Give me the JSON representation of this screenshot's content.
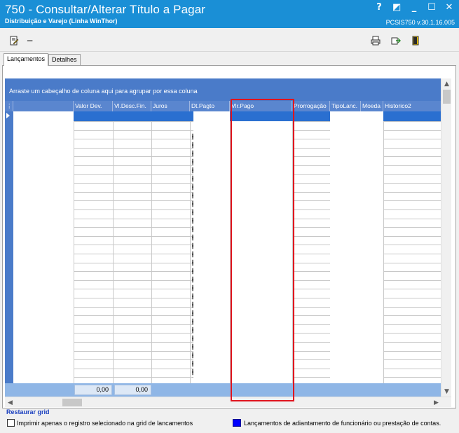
{
  "window": {
    "title": "750 - Consultar/Alterar Título a Pagar",
    "subtitle": "Distribuição e Varejo (Linha WinThor)",
    "version": "PCSIS750  v.30.1.16.005",
    "controls": [
      "?",
      "◩",
      "_",
      "☐",
      "✕"
    ]
  },
  "toolbar": {
    "left_icons": [
      "edit-document-icon",
      "minus-icon"
    ],
    "right_icons": [
      "print-icon",
      "export-icon",
      "exit-door-icon"
    ],
    "minus_glyph": "−"
  },
  "tabs": [
    {
      "label": "Lançamentos",
      "active": true
    },
    {
      "label": "Detalhes",
      "active": false
    }
  ],
  "grid": {
    "group_hint": "Arraste um cabeçalho de coluna aqui para agrupar por essa coluna",
    "columns": [
      "",
      "Valor Dev.",
      "Vl.Desc.Fin.",
      "Juros",
      "Dt.Pagto",
      "Vlr.Pago",
      "Prorrogação",
      "TipoLanc.",
      "Moeda",
      "Historico2"
    ],
    "totals": {
      "valor_dev": "0,00",
      "vl_desc_fin": "0,00"
    },
    "selection_color": "#2a6fd0",
    "header_color": "#5a86cf"
  },
  "footer": {
    "restore_label": "Restaurar grid",
    "print_only_label": "Imprimir apenas o registro selecionado na grid de lancamentos",
    "legend_label": "Lançamentos de adiantamento de funcionário ou prestação de contas.",
    "legend_color": "#0000ff"
  },
  "annotation": {
    "highlight_color": "#e0141e"
  }
}
